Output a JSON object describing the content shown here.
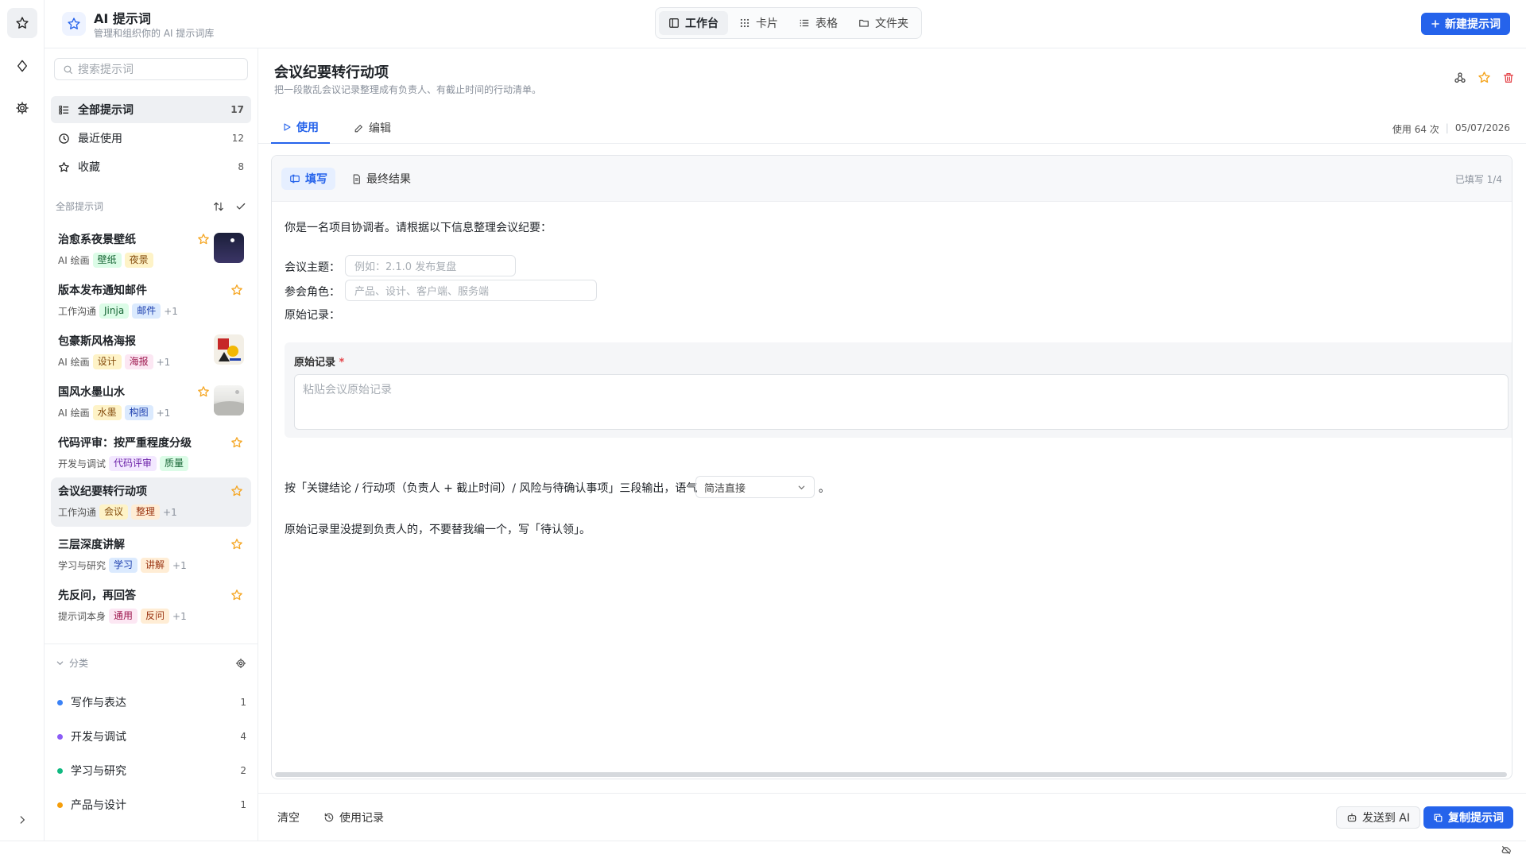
{
  "app": {
    "title": "AI 提示词",
    "subtitle": "管理和组织你的 AI 提示词库",
    "new_button": "新建提示词"
  },
  "views": [
    "工作台",
    "卡片",
    "表格",
    "文件夹"
  ],
  "sidebar": {
    "search_placeholder": "搜索提示词",
    "nav": [
      {
        "label": "全部提示词",
        "count": "17"
      },
      {
        "label": "最近使用",
        "count": "12"
      },
      {
        "label": "收藏",
        "count": "8"
      }
    ],
    "section_title": "全部提示词",
    "items": [
      {
        "title": "治愈系夜景壁纸",
        "category": "AI 绘画",
        "tags": [
          "壁纸",
          "夜景"
        ],
        "more": ""
      },
      {
        "title": "版本发布通知邮件",
        "category": "工作沟通",
        "tags": [
          "Jinja",
          "邮件"
        ],
        "more": "+1"
      },
      {
        "title": "包豪斯风格海报",
        "category": "AI 绘画",
        "tags": [
          "设计",
          "海报"
        ],
        "more": "+1"
      },
      {
        "title": "国风水墨山水",
        "category": "AI 绘画",
        "tags": [
          "水墨",
          "构图"
        ],
        "more": "+1"
      },
      {
        "title": "代码评审：按严重程度分级",
        "category": "开发与调试",
        "tags": [
          "代码评审",
          "质量"
        ],
        "more": ""
      },
      {
        "title": "会议纪要转行动项",
        "category": "工作沟通",
        "tags": [
          "会议",
          "整理"
        ],
        "more": "+1"
      },
      {
        "title": "三层深度讲解",
        "category": "学习与研究",
        "tags": [
          "学习",
          "讲解"
        ],
        "more": "+1"
      },
      {
        "title": "先反问，再回答",
        "category": "提示词本身",
        "tags": [
          "通用",
          "反问"
        ],
        "more": "+1"
      }
    ],
    "categories_title": "分类",
    "categories": [
      {
        "label": "写作与表达",
        "count": "1",
        "color": "#3b82f6"
      },
      {
        "label": "开发与调试",
        "count": "4",
        "color": "#8b5cf6"
      },
      {
        "label": "学习与研究",
        "count": "2",
        "color": "#10b981"
      },
      {
        "label": "产品与设计",
        "count": "1",
        "color": "#f59e0b"
      }
    ]
  },
  "main": {
    "title": "会议纪要转行动项",
    "description": "把一段散乱会议记录整理成有负责人、有截止时间的行动清单。",
    "tabs": [
      "使用",
      "编辑"
    ],
    "usage_count": "使用 64 次",
    "date": "05/07/2026",
    "subtabs": [
      "填写",
      "最终结果"
    ],
    "fill_progress": "已填写 1/4",
    "intro": "你是一名项目协调者。请根据以下信息整理会议纪要：",
    "fields": [
      {
        "label": "会议主题：",
        "placeholder": "例如：2.1.0 发布复盘"
      },
      {
        "label": "参会角色：",
        "placeholder": "产品、设计、客户端、服务端"
      }
    ],
    "raw_label": "原始记录：",
    "raw_block_label": "原始记录",
    "raw_required": "*",
    "raw_placeholder": "粘贴会议原始记录",
    "output_line": "按「关键结论 / 行动项（负责人 + 截止时间）/ 风险与待确认事项」三段输出，语气",
    "tone_value": "简洁直接",
    "period": "。",
    "note": "原始记录里没提到负责人的，不要替我编一个，写「待认领」。"
  },
  "footer": {
    "clear": "清空",
    "history": "使用记录",
    "send": "发送到 AI",
    "copy": "复制提示词"
  },
  "colors": {
    "accent": "#2563eb",
    "star": "#f5a623",
    "danger": "#e5484d"
  }
}
